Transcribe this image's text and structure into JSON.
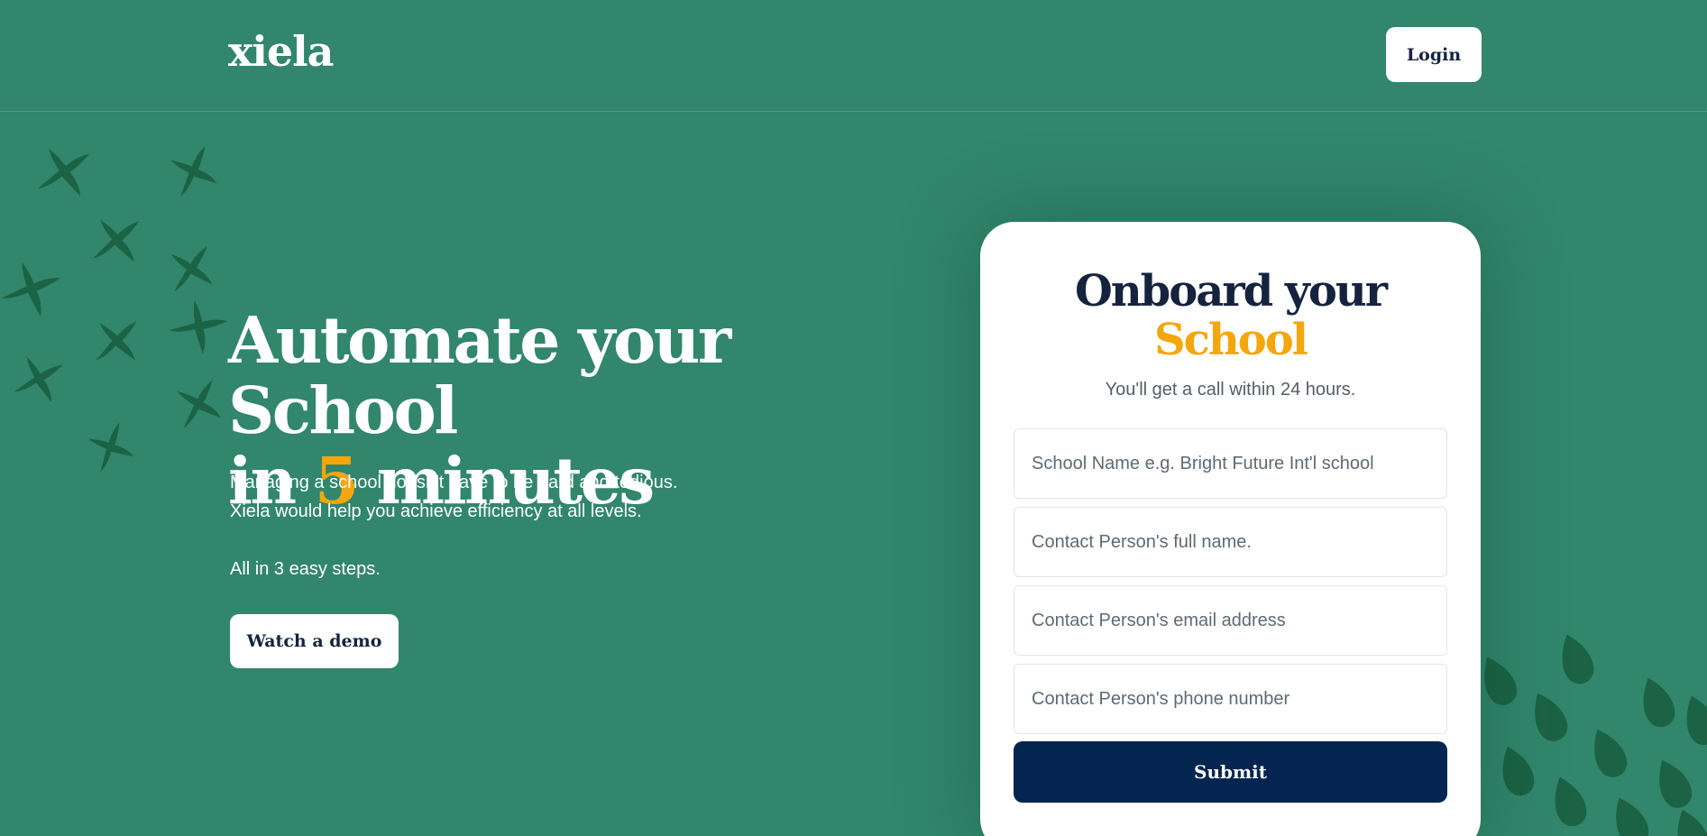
{
  "header": {
    "logo": "xiela",
    "login_label": "Login"
  },
  "hero": {
    "title_line1": "Automate your School",
    "title_in": "in ",
    "title_number": "5",
    "title_rest": " minutes",
    "description_line1": "Managing a school doesn't have to be hard and tedious.",
    "description_line2": "Xiela would help you achieve efficiency at all levels.",
    "steps": "All in 3 easy steps.",
    "demo_label": "Watch a demo"
  },
  "form": {
    "title_line1": "Onboard your",
    "title_line2": "School",
    "subtitle": "You'll get a call within 24 hours.",
    "school_name_placeholder": "School Name e.g. Bright Future Int'l school",
    "contact_name_placeholder": "Contact Person's full name.",
    "contact_email_placeholder": "Contact Person's email address",
    "contact_phone_placeholder": "Contact Person's phone number",
    "submit_label": "Submit"
  },
  "colors": {
    "background": "#31866c",
    "accent": "#f5a60b",
    "navy": "#03254f",
    "decoration": "#1b6344"
  },
  "icons": {
    "left_decoration": "cross-pattern-icon",
    "right_decoration": "leaf-pattern-icon"
  }
}
